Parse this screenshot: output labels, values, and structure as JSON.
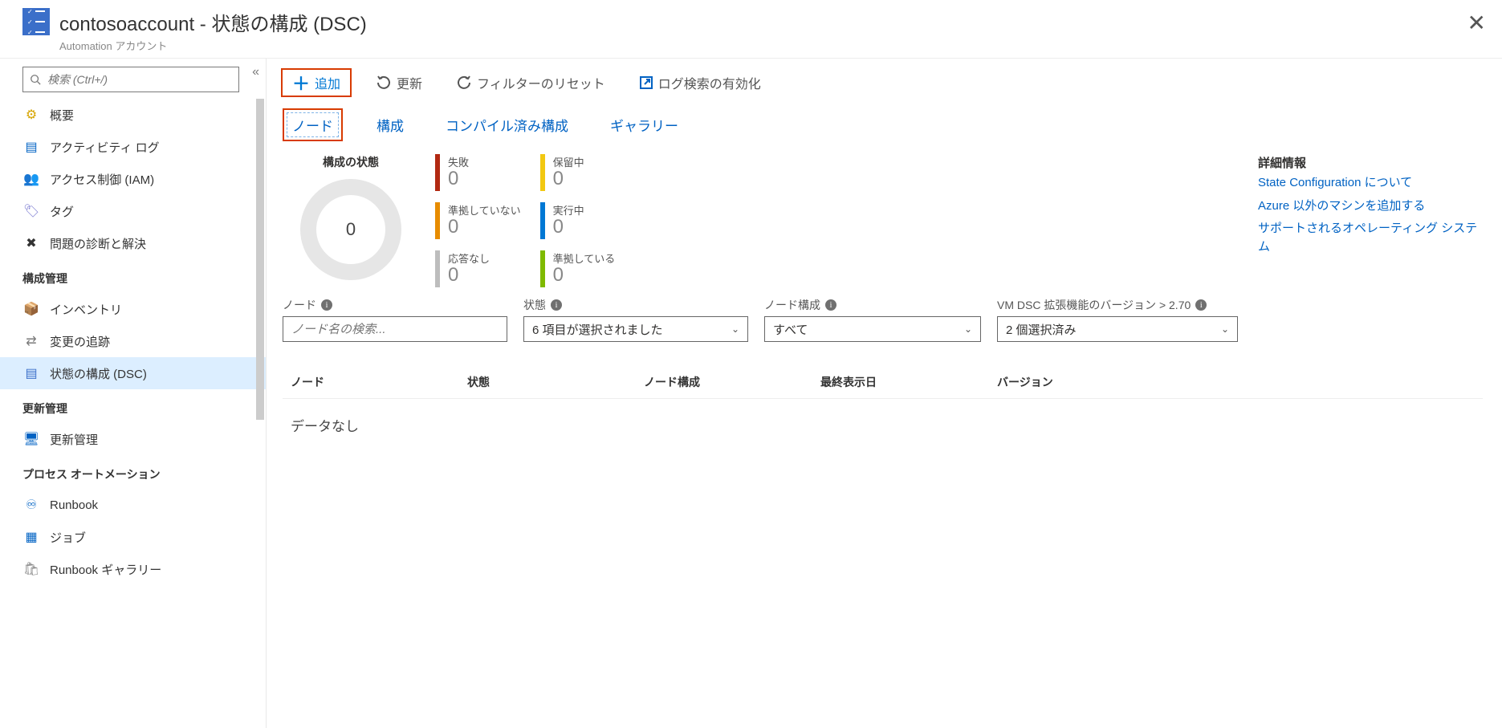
{
  "header": {
    "title": "contosoaccount - 状態の構成 (DSC)",
    "subtitle": "Automation アカウント"
  },
  "sidebar": {
    "search_placeholder": "検索 (Ctrl+/)",
    "items": [
      {
        "label": "概要",
        "icon": "⚙"
      },
      {
        "label": "アクティビティ ログ",
        "icon": "📘"
      },
      {
        "label": "アクセス制御 (IAM)",
        "icon": "👥"
      },
      {
        "label": "タグ",
        "icon": "🏷"
      },
      {
        "label": "問題の診断と解決",
        "icon": "🛠"
      }
    ],
    "sections": [
      {
        "title": "構成管理",
        "items": [
          {
            "label": "インベントリ",
            "icon": "📦"
          },
          {
            "label": "変更の追跡",
            "icon": "🔀"
          },
          {
            "label": "状態の構成 (DSC)",
            "icon": "📋",
            "selected": true
          }
        ]
      },
      {
        "title": "更新管理",
        "items": [
          {
            "label": "更新管理",
            "icon": "🖥"
          }
        ]
      },
      {
        "title": "プロセス オートメーション",
        "items": [
          {
            "label": "Runbook",
            "icon": "🔗"
          },
          {
            "label": "ジョブ",
            "icon": "▦"
          },
          {
            "label": "Runbook ギャラリー",
            "icon": "🛍"
          }
        ]
      }
    ]
  },
  "toolbar": {
    "add": "追加",
    "refresh": "更新",
    "reset": "フィルターのリセット",
    "logsearch": "ログ検索の有効化"
  },
  "tabs": {
    "nodes": "ノード",
    "config": "構成",
    "compiled": "コンパイル済み構成",
    "gallery": "ギャラリー"
  },
  "status": {
    "title": "構成の状態",
    "total": "0",
    "legend": [
      {
        "label": "失敗",
        "value": "0",
        "color": "#b22912"
      },
      {
        "label": "準拠していない",
        "value": "0",
        "color": "#e78c00"
      },
      {
        "label": "応答なし",
        "value": "0",
        "color": "#bdbdbd"
      },
      {
        "label": "保留中",
        "value": "0",
        "color": "#f2c811"
      },
      {
        "label": "実行中",
        "value": "0",
        "color": "#0078d4"
      },
      {
        "label": "準拠している",
        "value": "0",
        "color": "#7fba00"
      }
    ]
  },
  "info": {
    "title": "詳細情報",
    "links": [
      "State Configuration について",
      "Azure 以外のマシンを追加する",
      "サポートされるオペレーティング システム"
    ]
  },
  "filters": {
    "node": {
      "label": "ノード",
      "placeholder": "ノード名の検索..."
    },
    "state": {
      "label": "状態",
      "value": "6 項目が選択されました"
    },
    "nodecfg": {
      "label": "ノード構成",
      "value": "すべて"
    },
    "version": {
      "label": "VM DSC 拡張機能のバージョン > 2.70",
      "value": "2 個選択済み"
    }
  },
  "table": {
    "columns": [
      "ノード",
      "状態",
      "ノード構成",
      "最終表示日",
      "バージョン"
    ],
    "empty": "データなし"
  },
  "chart_data": {
    "type": "pie",
    "title": "構成の状態",
    "categories": [
      "失敗",
      "準拠していない",
      "応答なし",
      "保留中",
      "実行中",
      "準拠している"
    ],
    "values": [
      0,
      0,
      0,
      0,
      0,
      0
    ],
    "total": 0
  }
}
